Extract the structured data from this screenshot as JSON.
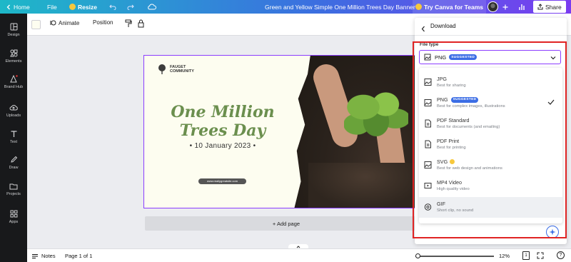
{
  "topbar": {
    "home": "Home",
    "file": "File",
    "resize": "Resize",
    "doc_title": "Green and Yellow Simple One Million Trees Day Banner",
    "try_canva": "Try Canva for Teams",
    "share": "Share"
  },
  "sidebar": {
    "items": [
      {
        "label": "Design",
        "icon": "layout-icon"
      },
      {
        "label": "Elements",
        "icon": "shapes-icon"
      },
      {
        "label": "Brand Hub",
        "icon": "brand-icon"
      },
      {
        "label": "Uploads",
        "icon": "cloud-upload-icon"
      },
      {
        "label": "Text",
        "icon": "text-icon"
      },
      {
        "label": "Draw",
        "icon": "pen-icon"
      },
      {
        "label": "Projects",
        "icon": "folder-icon"
      },
      {
        "label": "Apps",
        "icon": "grid-icon"
      }
    ]
  },
  "toolbar": {
    "animate": "Animate",
    "position": "Position"
  },
  "banner": {
    "org_line1": "FAUGET",
    "org_line2": "COMMUNITY",
    "title_line1": "One Million",
    "title_line2": "Trees Day",
    "date": "• 10 January 2023 •",
    "website": "www.reallygreatsite.com"
  },
  "canvas": {
    "add_page": "+ Add page"
  },
  "bottombar": {
    "notes": "Notes",
    "page": "Page 1 of 1",
    "zoom": "12%",
    "zoom_level": 0.12,
    "page_count": "1"
  },
  "download": {
    "title": "Download",
    "file_type_label": "File type",
    "selected": "PNG",
    "selected_badge": "SUGGESTED",
    "options": [
      {
        "name": "JPG",
        "desc": "Best for sharing",
        "badge": "",
        "icon": "image-file-icon"
      },
      {
        "name": "PNG",
        "desc": "Best for complex images, illustrations",
        "badge": "SUGGESTED",
        "icon": "image-file-icon"
      },
      {
        "name": "PDF Standard",
        "desc": "Best for documents (and emailing)",
        "badge": "",
        "icon": "document-icon"
      },
      {
        "name": "PDF Print",
        "desc": "Best for printing",
        "badge": "",
        "icon": "document-icon"
      },
      {
        "name": "SVG",
        "desc": "Best for web design and animations",
        "badge": "",
        "icon": "image-file-icon"
      },
      {
        "name": "MP4 Video",
        "desc": "High quality video",
        "badge": "",
        "icon": "video-icon"
      },
      {
        "name": "GIF",
        "desc": "Short clip, no sound",
        "badge": "",
        "icon": "gif-icon"
      }
    ]
  },
  "colors": {
    "accent": "#8b3dff",
    "badge": "#3b6de5",
    "title_green": "#6b8f4e",
    "highlight": "#e02424"
  }
}
